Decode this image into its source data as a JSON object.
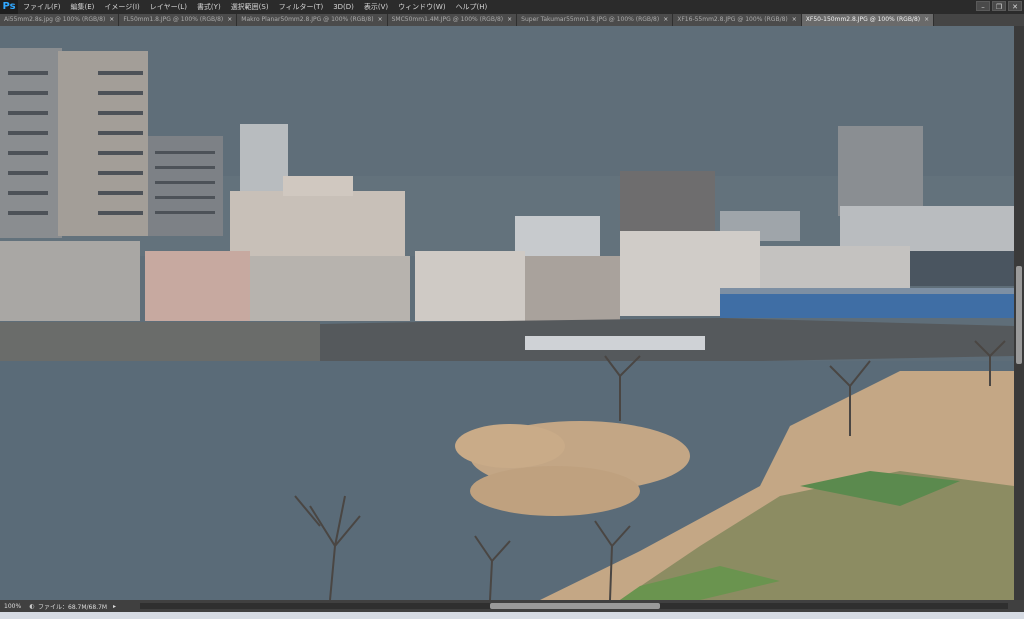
{
  "app": {
    "logo": "Ps"
  },
  "menu": [
    "ファイル(F)",
    "編集(E)",
    "イメージ(I)",
    "レイヤー(L)",
    "書式(Y)",
    "選択範囲(S)",
    "フィルター(T)",
    "3D(D)",
    "表示(V)",
    "ウィンドウ(W)",
    "ヘルプ(H)"
  ],
  "window_controls": [
    "–",
    "❐",
    "✕"
  ],
  "tabs": [
    {
      "label": "Ai55mm2.8s.jpg @ 100% (RGB/8)",
      "close": "×",
      "active": false
    },
    {
      "label": "FL50mm1.8.JPG @ 100% (RGB/8)",
      "close": "×",
      "active": false
    },
    {
      "label": "Makro Planar50mm2.8.JPG @ 100% (RGB/8)",
      "close": "×",
      "active": false
    },
    {
      "label": "SMC50mm1.4M.JPG @ 100% (RGB/8)",
      "close": "×",
      "active": false
    },
    {
      "label": "Super Takumar55mm1.8.JPG @ 100% (RGB/8)",
      "close": "×",
      "active": false
    },
    {
      "label": "XF16-55mm2.8.JPG @ 100% (RGB/8)",
      "close": "×",
      "active": false
    },
    {
      "label": "XF50-150mm2.8.JPG @ 100% (RGB/8)",
      "close": "×",
      "active": true
    }
  ],
  "status": {
    "zoom": "100%",
    "icon": "◐",
    "file": "ファイル：68.7M/68.7M",
    "arrow": "▸"
  },
  "colors": {
    "sky": "#5e6d78",
    "water": "#5a6b78",
    "reeds": "#c9a882",
    "bridge": "#3f6ea5"
  },
  "icons": {
    "logo": "ps-logo-icon",
    "status": "document-info-icon",
    "arrow": "play-arrow-icon"
  }
}
